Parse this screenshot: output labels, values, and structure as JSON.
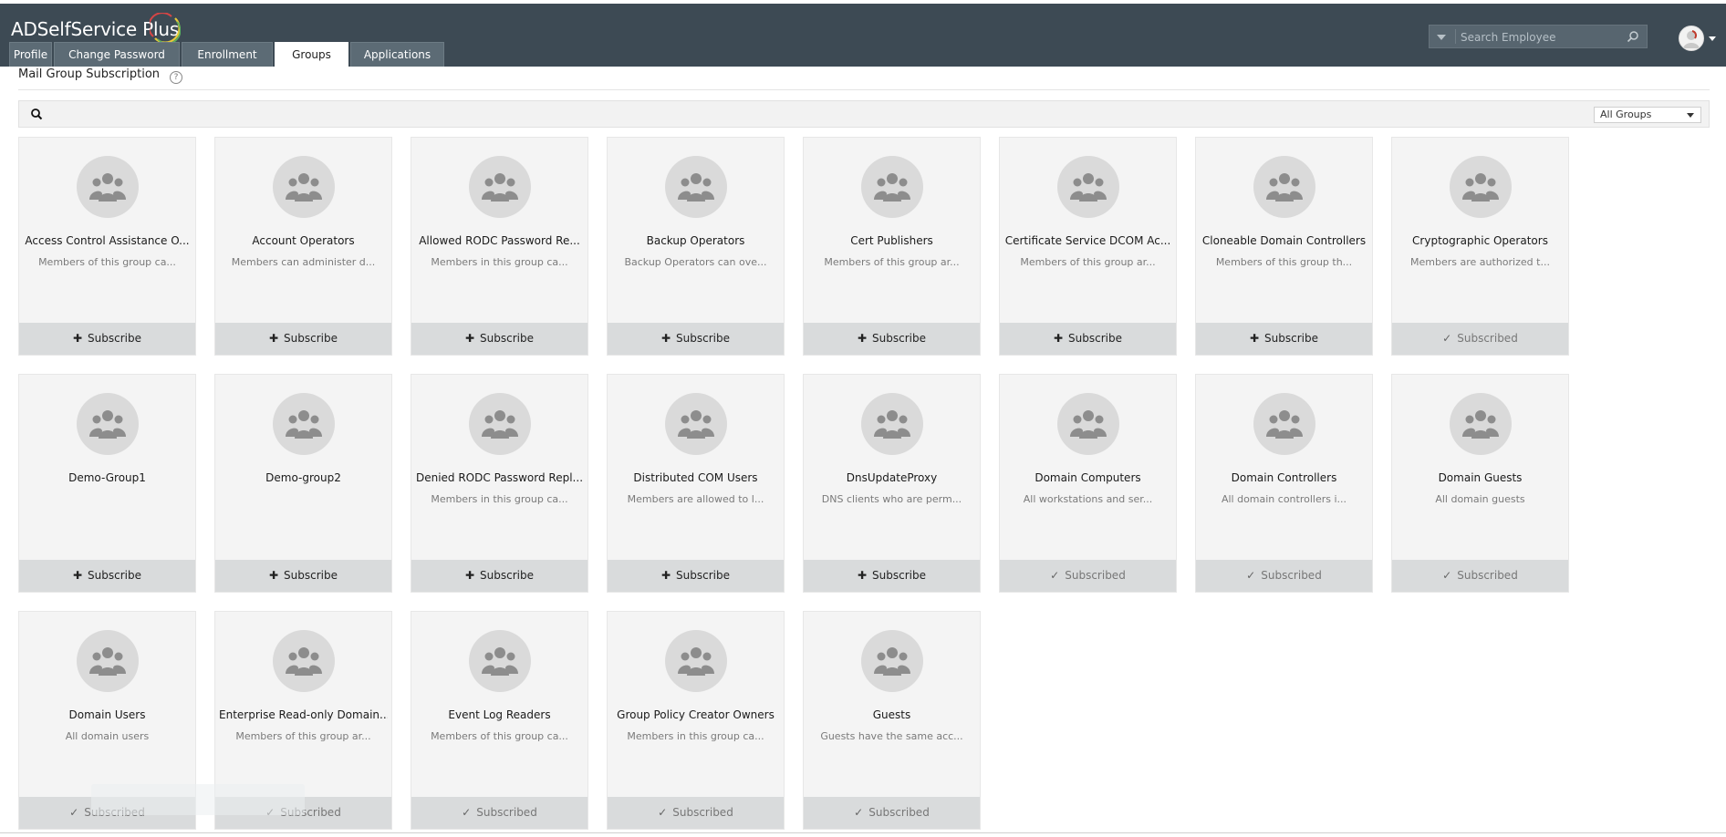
{
  "app": {
    "title": "ADSelfService Plus"
  },
  "colors": {
    "header_bg": "#3d4a54",
    "tab_bg": "#5c6b75",
    "card_bg": "#f4f4f4",
    "action_bg": "#d9dbdc"
  },
  "tabs": [
    {
      "label": "Profile",
      "active": false
    },
    {
      "label": "Change Password",
      "active": false
    },
    {
      "label": "Enrollment",
      "active": false
    },
    {
      "label": "Groups",
      "active": true
    },
    {
      "label": "Applications",
      "active": false
    }
  ],
  "search": {
    "placeholder": "Search Employee"
  },
  "page": {
    "title": "Mail Group Subscription",
    "filter_select": "All Groups"
  },
  "icons": {
    "group": "group-icon",
    "search": "search-icon",
    "help": "help-icon",
    "plus": "plus-icon",
    "check": "check-icon"
  },
  "labels": {
    "subscribe": "Subscribe",
    "subscribed": "Subscribed"
  },
  "groups": [
    {
      "name": "Access Control Assistance O...",
      "desc": "Members of this group ca...",
      "status": "Subscribe"
    },
    {
      "name": "Account Operators",
      "desc": "Members can administer d...",
      "status": "Subscribe"
    },
    {
      "name": "Allowed RODC Password Re...",
      "desc": "Members in this group ca...",
      "status": "Subscribe"
    },
    {
      "name": "Backup Operators",
      "desc": "Backup Operators can ove...",
      "status": "Subscribe"
    },
    {
      "name": "Cert Publishers",
      "desc": "Members of this group ar...",
      "status": "Subscribe"
    },
    {
      "name": "Certificate Service DCOM Ac...",
      "desc": "Members of this group ar...",
      "status": "Subscribe"
    },
    {
      "name": "Cloneable Domain Controllers",
      "desc": "Members of this group th...",
      "status": "Subscribe"
    },
    {
      "name": "Cryptographic Operators",
      "desc": "Members are authorized t...",
      "status": "Subscribed"
    },
    {
      "name": "Demo-Group1",
      "desc": "",
      "status": "Subscribe"
    },
    {
      "name": "Demo-group2",
      "desc": "",
      "status": "Subscribe"
    },
    {
      "name": "Denied RODC Password Repl...",
      "desc": "Members in this group ca...",
      "status": "Subscribe"
    },
    {
      "name": "Distributed COM Users",
      "desc": "Members are allowed to l...",
      "status": "Subscribe"
    },
    {
      "name": "DnsUpdateProxy",
      "desc": "DNS clients who are perm...",
      "status": "Subscribe"
    },
    {
      "name": "Domain Computers",
      "desc": "All workstations and ser...",
      "status": "Subscribed"
    },
    {
      "name": "Domain Controllers",
      "desc": "All domain controllers i...",
      "status": "Subscribed"
    },
    {
      "name": "Domain Guests",
      "desc": "All domain guests",
      "status": "Subscribed"
    },
    {
      "name": "Domain Users",
      "desc": "All domain users",
      "status": "Subscribed"
    },
    {
      "name": "Enterprise Read-only Domain...",
      "desc": "Members of this group ar...",
      "status": "Subscribed"
    },
    {
      "name": "Event Log Readers",
      "desc": "Members of this group ca...",
      "status": "Subscribed"
    },
    {
      "name": "Group Policy Creator Owners",
      "desc": "Members in this group ca...",
      "status": "Subscribed"
    },
    {
      "name": "Guests",
      "desc": "Guests have the same acc...",
      "status": "Subscribed"
    }
  ]
}
